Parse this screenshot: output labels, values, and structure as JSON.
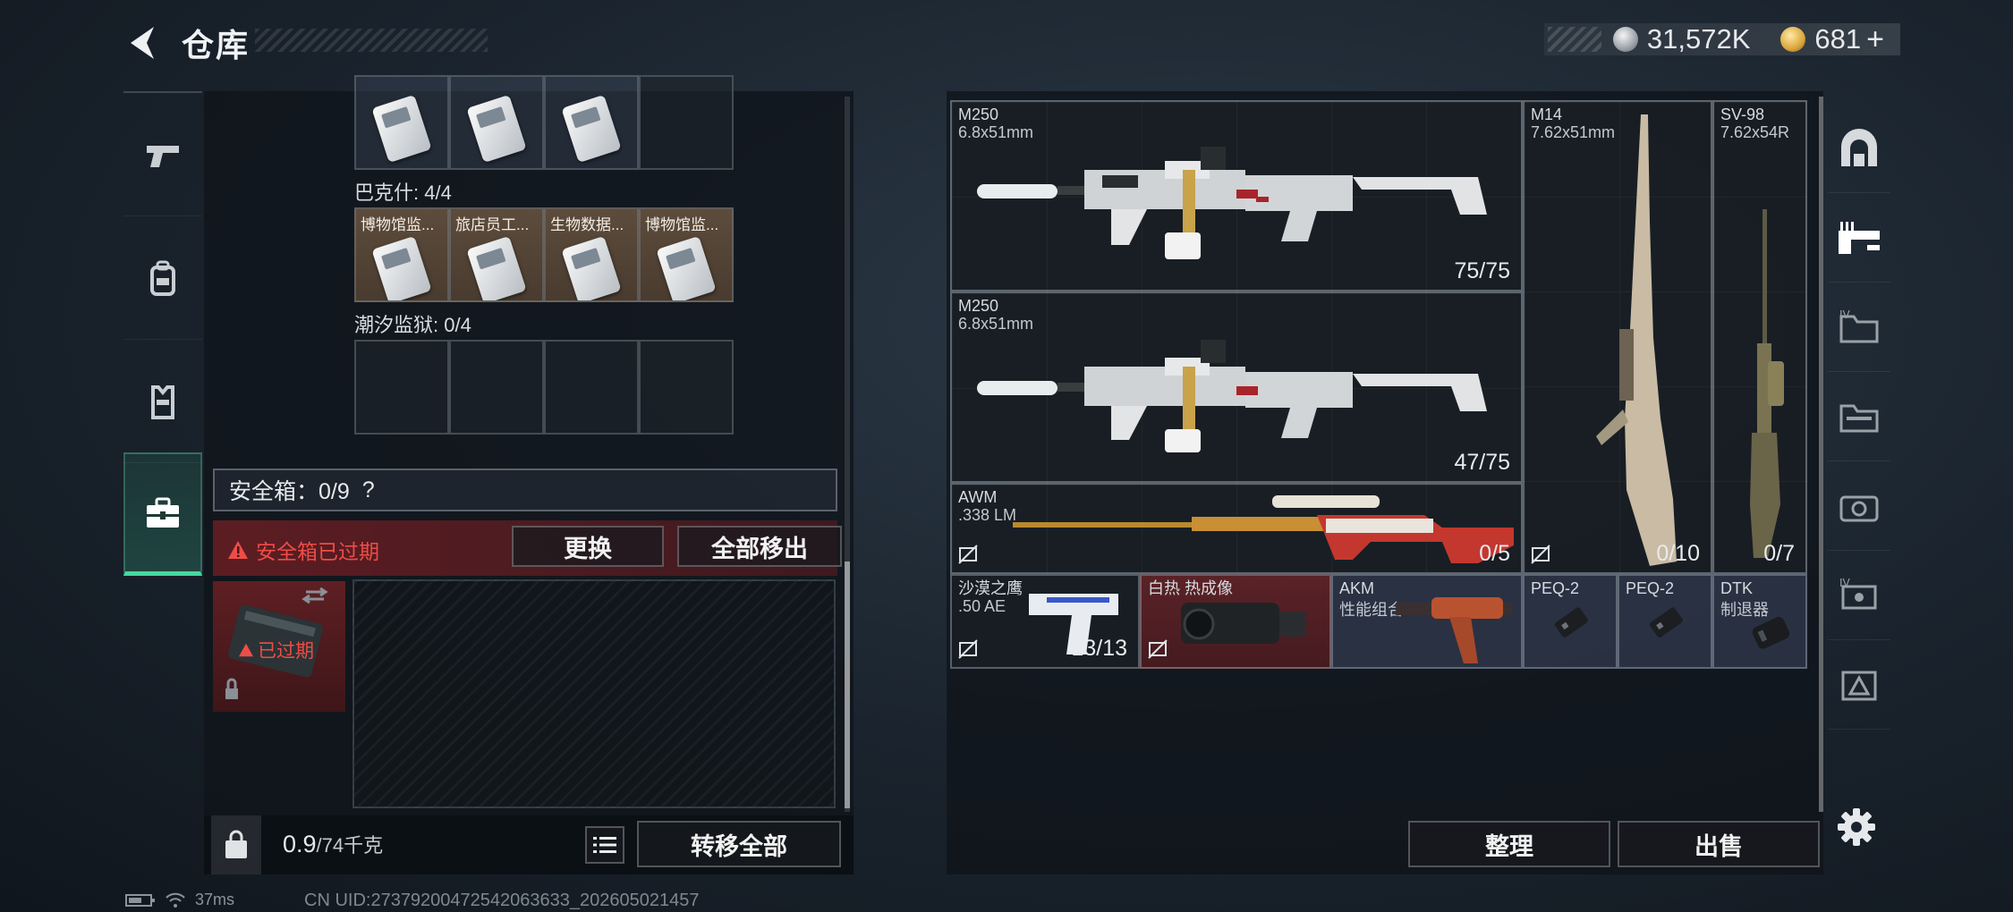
{
  "header": {
    "title": "仓库",
    "currency_1": "31,572K",
    "currency_2": "681",
    "add_symbol": "+"
  },
  "rail_tabs": [
    "pistol-icon",
    "backpack-icon",
    "vest-icon",
    "briefcase-icon"
  ],
  "collection": {
    "row_top_cards": 3,
    "group_1": {
      "label": "巴克什: 4/4",
      "items": [
        "博物馆监...",
        "旅店员工...",
        "生物数据...",
        "博物馆监..."
      ]
    },
    "group_2": {
      "label": "潮汐监狱: 0/4"
    }
  },
  "safebox": {
    "label": "安全箱：0/9",
    "help": "?",
    "expired_notice": "安全箱已过期",
    "replace_button": "更换",
    "move_all_out_button": "全部移出",
    "expired_tag": "已过期"
  },
  "footer_left": {
    "weight_value": "0.9",
    "weight_max": "/74千克",
    "transfer_all_button": "转移全部"
  },
  "weapons": [
    {
      "name": "M250",
      "caliber": "6.8x51mm",
      "ammo": "75/75"
    },
    {
      "name": "M250",
      "caliber": "6.8x51mm",
      "ammo": "47/75"
    },
    {
      "name": "AWM",
      "caliber": ".338 LM",
      "ammo": "0/5"
    },
    {
      "name": "M14",
      "caliber": "7.62x51mm",
      "ammo": "0/10"
    },
    {
      "name": "SV-98",
      "caliber": "7.62x54R",
      "ammo": "0/7"
    }
  ],
  "accessories": [
    {
      "name": "沙漠之鹰",
      "sub": ".50 AE",
      "ammo": "13/13"
    },
    {
      "name": "白热 热成像",
      "sub": ""
    },
    {
      "name": "AKM",
      "sub": "性能组合"
    },
    {
      "name": "PEQ-2",
      "sub": ""
    },
    {
      "name": "PEQ-2",
      "sub": ""
    },
    {
      "name": "DTK",
      "sub": "制退器"
    }
  ],
  "footer_right": {
    "organize_button": "整理",
    "sell_button": "出售"
  },
  "status_bar": {
    "ping": "37ms",
    "uid": "CN UID:27379200472542063633_202605021457"
  },
  "colors": {
    "accent_green": "#46d7a0",
    "warning_red": "#ef4c47",
    "expired_bg": "#5c1d22"
  }
}
